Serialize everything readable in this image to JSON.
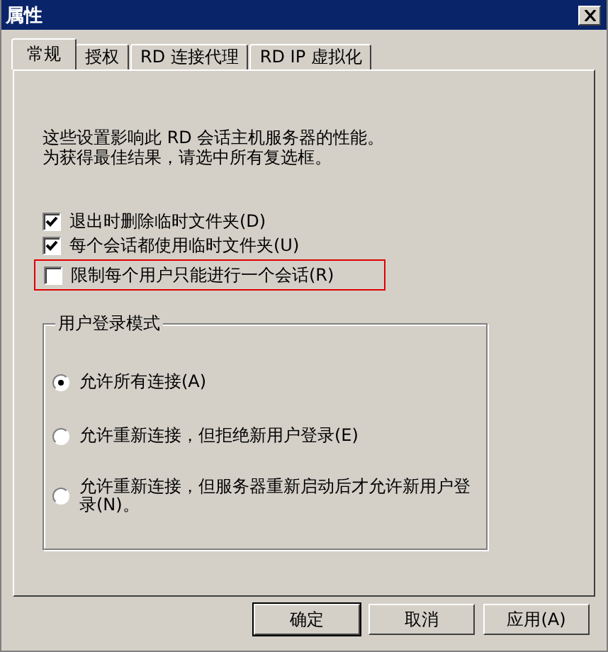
{
  "window": {
    "title": "属性"
  },
  "tabs": [
    {
      "label": "常规",
      "selected": true
    },
    {
      "label": "授权",
      "selected": false
    },
    {
      "label": "RD 连接代理",
      "selected": false
    },
    {
      "label": "RD IP 虚拟化",
      "selected": false
    }
  ],
  "description": [
    "这些设置影响此 RD 会话主机服务器的性能。",
    "为获得最佳结果，请选中所有复选框。"
  ],
  "checkboxes": [
    {
      "label": "退出时删除临时文件夹(D)",
      "checked": true,
      "highlighted": false
    },
    {
      "label": "每个会话都使用临时文件夹(U)",
      "checked": true,
      "highlighted": false
    },
    {
      "label": "限制每个用户只能进行一个会话(R)",
      "checked": false,
      "highlighted": true
    }
  ],
  "login_mode": {
    "title": "用户登录模式",
    "options": [
      {
        "label": "允许所有连接(A)",
        "selected": true
      },
      {
        "label": "允许重新连接，但拒绝新用户登录(E)",
        "selected": false
      },
      {
        "label": "允许重新连接，但服务器重新启动后才允许新用户登录(N)。",
        "selected": false
      }
    ]
  },
  "buttons": [
    "确定",
    "取消",
    "应用(A)"
  ]
}
